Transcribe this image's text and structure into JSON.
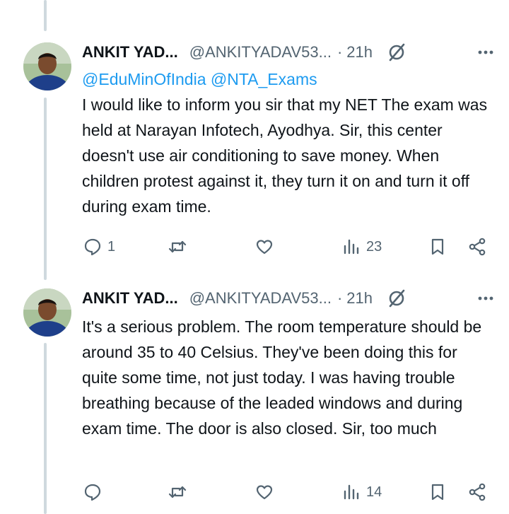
{
  "tweets": [
    {
      "name": "ANKIT YAD...",
      "handle": "@ANKITYADAV53...",
      "separator": "·",
      "time": "21h",
      "mentions": "@EduMinOfIndia @NTA_Exams",
      "text": "I would like to inform you sir that my NET The exam was held at Narayan Infotech, Ayodhya. Sir, this center doesn't use air conditioning to save money. When children protest against it, they turn it on and turn it off during exam time.",
      "replies": "1",
      "retweets": "",
      "likes": "",
      "views": "23"
    },
    {
      "name": "ANKIT YAD...",
      "handle": "@ANKITYADAV53...",
      "separator": "·",
      "time": "21h",
      "mentions": "",
      "text": "It's a serious problem. The room temperature should be around 35 to 40 Celsius. They've been doing this for quite some time, not just today. I was having trouble breathing because of the leaded windows and during exam time. The door is also closed. Sir, too much",
      "replies": "",
      "retweets": "",
      "likes": "",
      "views": "14"
    }
  ],
  "icons": {
    "reply": "reply-icon",
    "retweet": "retweet-icon",
    "like": "heart-icon",
    "views": "views-icon",
    "bookmark": "bookmark-icon",
    "share": "share-icon",
    "grok": "grok-icon",
    "more": "more-icon"
  },
  "colors": {
    "mention": "#1d9bf0",
    "secondary": "#536471",
    "thread_line": "#cfd9de"
  }
}
